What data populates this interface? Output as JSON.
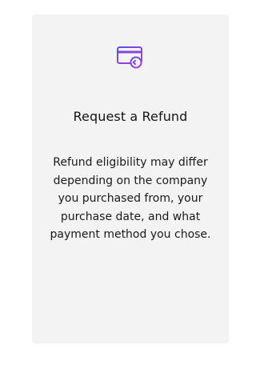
{
  "card": {
    "icon": "refund-card-icon",
    "title": "Request a Refund",
    "description": "Refund eligibility may differ depending on the company you purchased from, your purchase date, and what payment method you chose."
  },
  "colors": {
    "icon_gradient_start": "#5b4ee8",
    "icon_gradient_end": "#b03bd6",
    "card_background": "#f3f3f3"
  }
}
